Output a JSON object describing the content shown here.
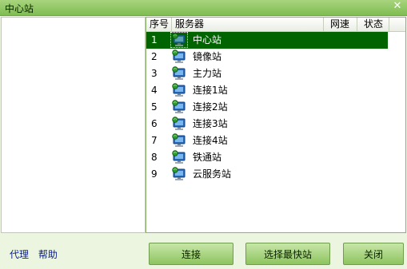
{
  "window": {
    "title": "中心站",
    "close_glyph": "✕"
  },
  "list": {
    "columns": [
      "序号",
      "服务器",
      "网速",
      "状态"
    ],
    "rows": [
      {
        "num": "1",
        "name": "中心站",
        "selected": true
      },
      {
        "num": "2",
        "name": "镜像站"
      },
      {
        "num": "3",
        "name": "主力站"
      },
      {
        "num": "4",
        "name": "连接1站"
      },
      {
        "num": "5",
        "name": "连接2站"
      },
      {
        "num": "6",
        "name": "连接3站"
      },
      {
        "num": "7",
        "name": "连接4站"
      },
      {
        "num": "8",
        "name": "铁通站"
      },
      {
        "num": "9",
        "name": "云服务站"
      }
    ],
    "row_icon": "server-computer-icon"
  },
  "links": {
    "proxy": "代理",
    "help": "帮助"
  },
  "buttons": {
    "connect": "连接",
    "fastest": "选择最快站",
    "close": "关闭"
  },
  "colors": {
    "selected_row": "#006400",
    "title_bar": "#8cc65f",
    "button": "#a9d47f",
    "link": "#0b1f8c"
  }
}
